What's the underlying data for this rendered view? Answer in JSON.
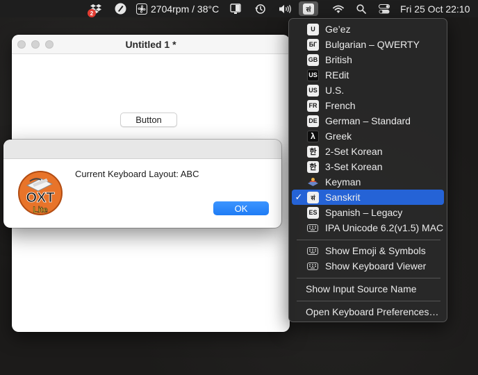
{
  "menubar": {
    "dropbox_badge": "2",
    "stats": "2704rpm / 38°C",
    "input_source_glyph": "सं",
    "datetime": "Fri 25 Oct  22:10",
    "icons": [
      "dropbox-icon",
      "artstudio-icon",
      "fan-icon",
      "display-icon",
      "time-machine-icon",
      "volume-icon",
      "input-source-icon",
      "wifi-icon",
      "search-icon",
      "control-center-icon"
    ]
  },
  "window": {
    "title": "Untitled 1 *",
    "button_label": "Button"
  },
  "alert": {
    "message": "Current Keyboard Layout: ABC",
    "ok_label": "OK",
    "logo_text": "OXT",
    "logo_subtext": "Lite"
  },
  "input_menu": {
    "items": [
      {
        "icon": "U",
        "label": "Ge’ez"
      },
      {
        "icon": "БГ",
        "label": "Bulgarian – QWERTY"
      },
      {
        "icon": "GB",
        "label": "British"
      },
      {
        "icon": "US",
        "label": "REdit"
      },
      {
        "icon": "US",
        "label": "U.S."
      },
      {
        "icon": "FR",
        "label": "French"
      },
      {
        "icon": "DE",
        "label": "German – Standard"
      },
      {
        "icon": "λ",
        "label": "Greek"
      },
      {
        "icon": "한",
        "label": "2-Set Korean"
      },
      {
        "icon": "한",
        "label": "3-Set Korean"
      },
      {
        "icon": "",
        "label": "Keyman"
      },
      {
        "icon": "सं",
        "label": "Sanskrit",
        "checked": "✓"
      },
      {
        "icon": "ES",
        "label": "Spanish – Legacy"
      },
      {
        "icon": "",
        "label": "IPA Unicode 6.2(v1.5) MAC"
      }
    ],
    "show_emoji": "Show Emoji & Symbols",
    "show_keyboard_viewer": "Show Keyboard Viewer",
    "show_input_source_name": "Show Input Source Name",
    "open_prefs": "Open Keyboard Preferences…"
  },
  "colors": {
    "accent": "#2563d6",
    "ok_button": "#1f7cf5",
    "menu_bg": "#282828"
  }
}
